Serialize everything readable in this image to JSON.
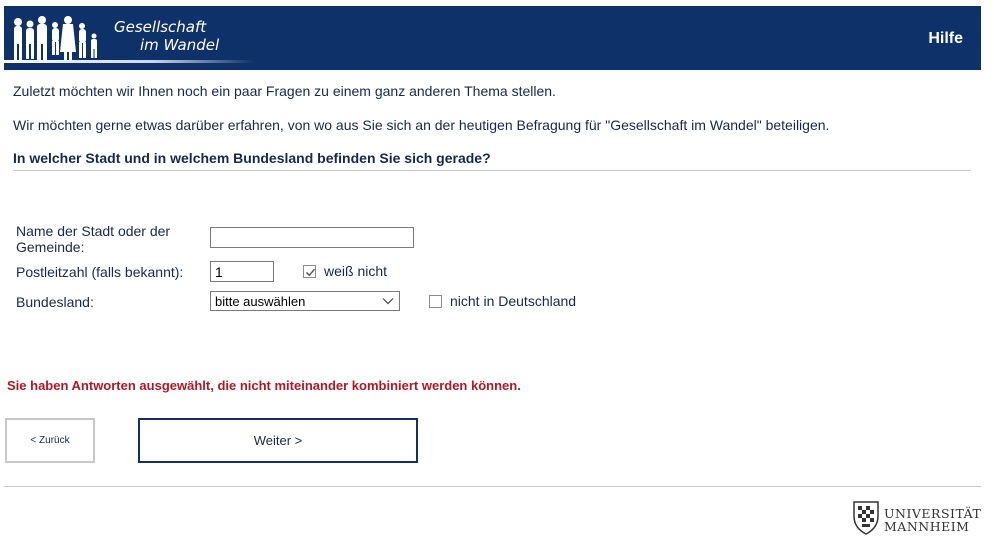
{
  "header": {
    "logo_line1": "Gesellschaft",
    "logo_line2": "im Wandel",
    "help_label": "Hilfe"
  },
  "intro": {
    "line1": "Zuletzt möchten wir Ihnen noch ein paar Fragen zu einem ganz anderen Thema stellen.",
    "line2": "Wir möchten gerne etwas darüber erfahren, von wo aus Sie sich an der heutigen Befragung für \"Gesellschaft im Wandel\" beteiligen."
  },
  "question": "In welcher Stadt und in welchem Bundesland befinden Sie sich gerade?",
  "form": {
    "city_label": "Name der Stadt oder der Gemeinde:",
    "city_value": "",
    "zip_label": "Postleitzahl (falls bekannt):",
    "zip_value": "1",
    "unknown_label": "weiß nicht",
    "unknown_checked": true,
    "state_label": "Bundesland:",
    "state_selected": "bitte auswählen",
    "not_germany_label": "nicht in Deutschland",
    "not_germany_checked": false
  },
  "error_message": "Sie haben Antworten ausgewählt, die nicht miteinander kombiniert werden können.",
  "nav": {
    "back_label": "< Zurück",
    "next_label": "Weiter >"
  },
  "footer": {
    "university_line1": "UNIVERSITÄT",
    "university_line2": "MANNHEIM"
  },
  "colors": {
    "header_bg": "#0d3168",
    "error": "#b01822",
    "text": "#17284d"
  }
}
